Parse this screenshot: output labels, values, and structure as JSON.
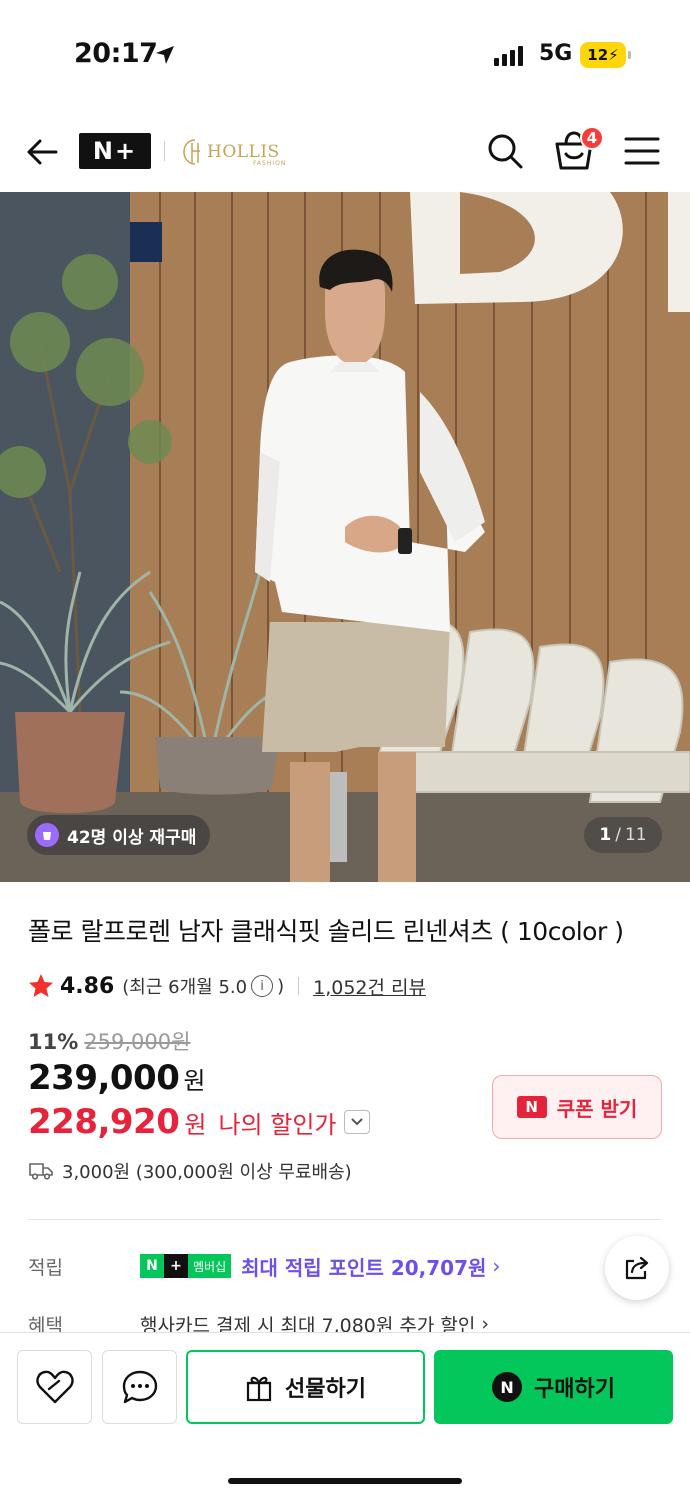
{
  "status": {
    "time": "20:17",
    "network": "5G",
    "battery": "12"
  },
  "nav": {
    "brand_badge": "N+",
    "store_name": "HOLLIS",
    "store_sub": "FASHION",
    "cart_count": "4"
  },
  "hero": {
    "repurchase": "42명 이상 재구매",
    "page_current": "1",
    "page_sep": "/",
    "page_total": "11"
  },
  "product": {
    "title": "폴로 랄프로렌 남자 클래식핏 솔리드 린넨셔츠 ( 10color )",
    "rating": "4.86",
    "recent_open": "(최근 6개월 5.0",
    "recent_close": ")",
    "reviews": "1,052건 리뷰",
    "discount_rate": "11%",
    "original_price": "259,000원",
    "price": "239,000",
    "price_unit": "원",
    "my_price": "228,920",
    "my_price_unit": "원",
    "my_price_label": "나의 할인가",
    "coupon_label": "쿠폰 받기",
    "coupon_icon": "N",
    "shipping": "3,000원 (300,000원 이상 무료배송)"
  },
  "benefits": {
    "points_label": "적립",
    "membership_n": "N",
    "membership_plus": "+",
    "membership_text": "멤버십",
    "points_text": "최대 적립 포인트 20,707원",
    "benefit_label": "혜택",
    "benefit_text": "행사카드 결제 시 최대 7,080원 추가 할인"
  },
  "bottom": {
    "gift_label": "선물하기",
    "buy_label": "구매하기",
    "buy_icon": "N"
  },
  "colors": {
    "accent_green": "#03c75a",
    "price_red": "#e5243b",
    "points_purple": "#6e4fe8"
  },
  "icons": [
    "back-arrow-icon",
    "search-icon",
    "cart-icon",
    "menu-icon",
    "star-icon",
    "info-icon",
    "chevron-down-icon",
    "truck-icon",
    "share-icon",
    "heart-icon",
    "chat-icon",
    "gift-icon"
  ]
}
